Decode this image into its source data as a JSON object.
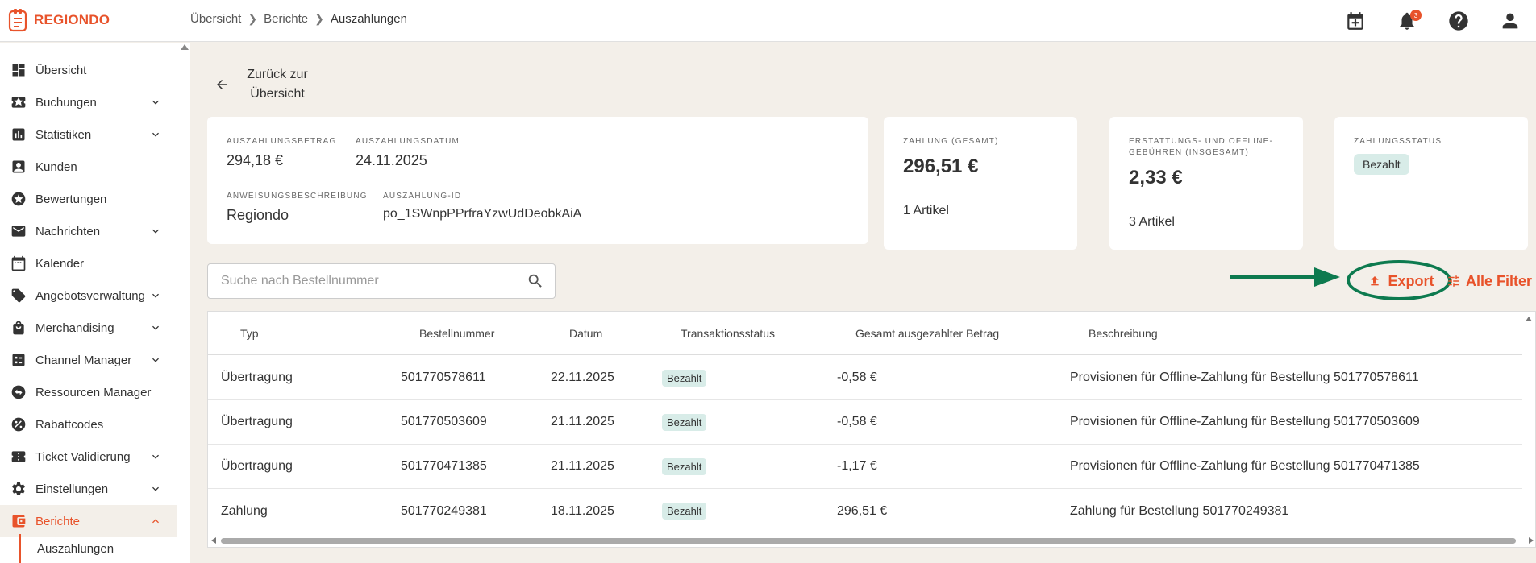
{
  "app": {
    "logo_text": "REGIONDO",
    "brand_color": "#e8532b",
    "annotation_color": "#0d7a4f"
  },
  "breadcrumb": {
    "items": [
      "Übersicht",
      "Berichte",
      "Auszahlungen"
    ]
  },
  "topbar": {
    "notification_count": "3",
    "icons": [
      "calendar-add-icon",
      "bell-icon",
      "help-icon",
      "account-icon"
    ]
  },
  "sidebar": {
    "items": [
      {
        "label": "Übersicht",
        "icon": "dashboard-icon",
        "expandable": false
      },
      {
        "label": "Buchungen",
        "icon": "ticket-star-icon",
        "expandable": true
      },
      {
        "label": "Statistiken",
        "icon": "bar-chart-icon",
        "expandable": true
      },
      {
        "label": "Kunden",
        "icon": "contact-icon",
        "expandable": false
      },
      {
        "label": "Bewertungen",
        "icon": "star-icon",
        "expandable": false
      },
      {
        "label": "Nachrichten",
        "icon": "mail-icon",
        "expandable": true
      },
      {
        "label": "Kalender",
        "icon": "calendar-icon",
        "expandable": false
      },
      {
        "label": "Angebotsverwaltung",
        "icon": "tag-icon",
        "expandable": true
      },
      {
        "label": "Merchandising",
        "icon": "shopping-bag-icon",
        "expandable": true
      },
      {
        "label": "Channel Manager",
        "icon": "list-icon",
        "expandable": true
      },
      {
        "label": "Ressourcen Manager",
        "icon": "swap-icon",
        "expandable": false
      },
      {
        "label": "Rabattcodes",
        "icon": "percent-icon",
        "expandable": false
      },
      {
        "label": "Ticket Validierung",
        "icon": "ticket-icon",
        "expandable": true
      },
      {
        "label": "Einstellungen",
        "icon": "gear-icon",
        "expandable": true
      },
      {
        "label": "Berichte",
        "icon": "wallet-icon",
        "expandable": true,
        "active": true
      }
    ],
    "sub_item": "Auszahlungen"
  },
  "back": {
    "label": "Zurück zur Übersicht"
  },
  "payout_card": {
    "amount_label": "AUSZAHLUNGSBETRAG",
    "amount": "294,18 €",
    "date_label": "AUSZAHLUNGSDATUM",
    "date": "24.11.2025",
    "desc_label": "ANWEISUNGSBESCHREIBUNG",
    "desc": "Regiondo",
    "id_label": "AUSZAHLUNG-ID",
    "id": "po_1SWnpPPrfraYzwUdDeobkAiA"
  },
  "summary_cards": {
    "payment": {
      "label": "ZAHLUNG (GESAMT)",
      "value": "296,51 €",
      "sub": "1 Artikel"
    },
    "fees": {
      "label": "ERSTATTUNGS- UND OFFLINE-GEBÜHREN (INSGESAMT)",
      "value": "2,33 €",
      "sub": "3 Artikel"
    },
    "status": {
      "label": "ZAHLUNGSSTATUS",
      "value": "Bezahlt"
    }
  },
  "search": {
    "placeholder": "Suche nach Bestellnummer",
    "value": ""
  },
  "actions": {
    "export_label": "Export",
    "filter_label": "Alle Filter"
  },
  "table": {
    "columns": [
      "Typ",
      "Bestellnummer",
      "Datum",
      "Transaktionsstatus",
      "Gesamt ausgezahlter Betrag",
      "Beschreibung"
    ],
    "rows": [
      {
        "typ": "Übertragung",
        "nr": "501770578611",
        "datum": "22.11.2025",
        "status": "Bezahlt",
        "betrag": "-0,58 €",
        "beschreibung": "Provisionen für Offline-Zahlung für Bestellung 501770578611"
      },
      {
        "typ": "Übertragung",
        "nr": "501770503609",
        "datum": "21.11.2025",
        "status": "Bezahlt",
        "betrag": "-0,58 €",
        "beschreibung": "Provisionen für Offline-Zahlung für Bestellung 501770503609"
      },
      {
        "typ": "Übertragung",
        "nr": "501770471385",
        "datum": "21.11.2025",
        "status": "Bezahlt",
        "betrag": "-1,17 €",
        "beschreibung": "Provisionen für Offline-Zahlung für Bestellung 501770471385"
      },
      {
        "typ": "Zahlung",
        "nr": "501770249381",
        "datum": "18.11.2025",
        "status": "Bezahlt",
        "betrag": "296,51 €",
        "beschreibung": "Zahlung für Bestellung 501770249381"
      }
    ]
  }
}
